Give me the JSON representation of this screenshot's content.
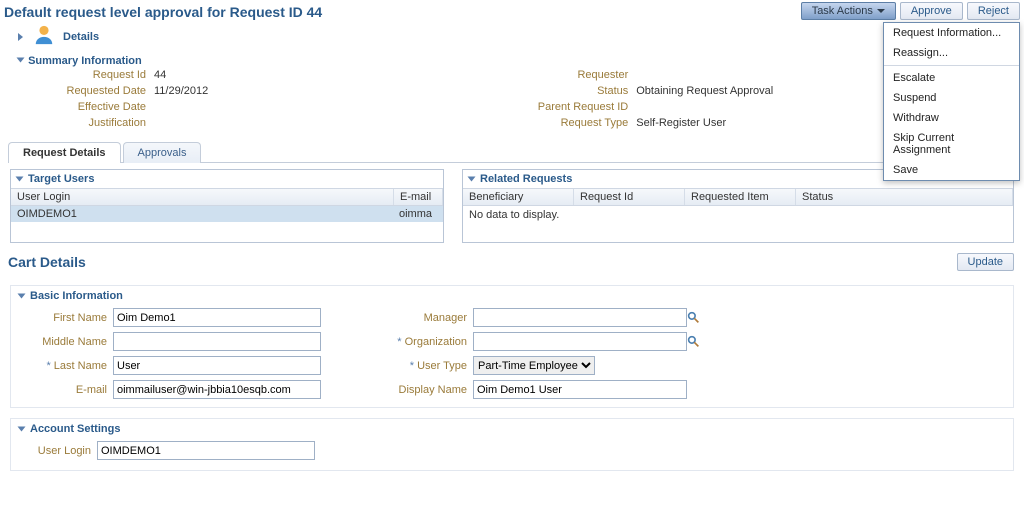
{
  "header": {
    "title": "Default request level approval for Request ID 44",
    "task_actions_label": "Task Actions",
    "approve_label": "Approve",
    "reject_label": "Reject",
    "menu": {
      "request_info": "Request Information...",
      "reassign": "Reassign...",
      "escalate": "Escalate",
      "suspend": "Suspend",
      "withdraw": "Withdraw",
      "skip": "Skip Current Assignment",
      "save": "Save"
    }
  },
  "details_label": "Details",
  "summary": {
    "label": "Summary Information",
    "left": {
      "request_id_k": "Request Id",
      "request_id_v": "44",
      "requested_date_k": "Requested Date",
      "requested_date_v": "11/29/2012",
      "effective_date_k": "Effective Date",
      "effective_date_v": "",
      "justification_k": "Justification",
      "justification_v": ""
    },
    "right": {
      "requester_k": "Requester",
      "requester_v": "",
      "status_k": "Status",
      "status_v": "Obtaining Request Approval",
      "parent_k": "Parent Request ID",
      "parent_v": "",
      "type_k": "Request Type",
      "type_v": "Self-Register User"
    }
  },
  "tabs": {
    "request_details": "Request Details",
    "approvals": "Approvals"
  },
  "target_users": {
    "title": "Target Users",
    "col_login": "User Login",
    "col_email": "E-mail",
    "row_login": "OIMDEMO1",
    "row_email": "oimma"
  },
  "related": {
    "title": "Related Requests",
    "c1": "Beneficiary",
    "c2": "Request Id",
    "c3": "Requested Item",
    "c4": "Status",
    "nodata": "No data to display."
  },
  "cart": {
    "title": "Cart Details",
    "update": "Update"
  },
  "basic": {
    "title": "Basic Information",
    "first_k": "First Name",
    "first_v": "Oim Demo1",
    "middle_k": "Middle Name",
    "middle_v": "",
    "last_k": "Last Name",
    "last_v": "User",
    "email_k": "E-mail",
    "email_v": "oimmailuser@win-jbbia10esqb.com",
    "manager_k": "Manager",
    "manager_v": "",
    "org_k": "Organization",
    "org_v": "",
    "ut_k": "User Type",
    "ut_v": "Part-Time Employee",
    "dn_k": "Display Name",
    "dn_v": "Oim Demo1 User"
  },
  "acct": {
    "title": "Account Settings",
    "login_k": "User Login",
    "login_v": "OIMDEMO1"
  }
}
